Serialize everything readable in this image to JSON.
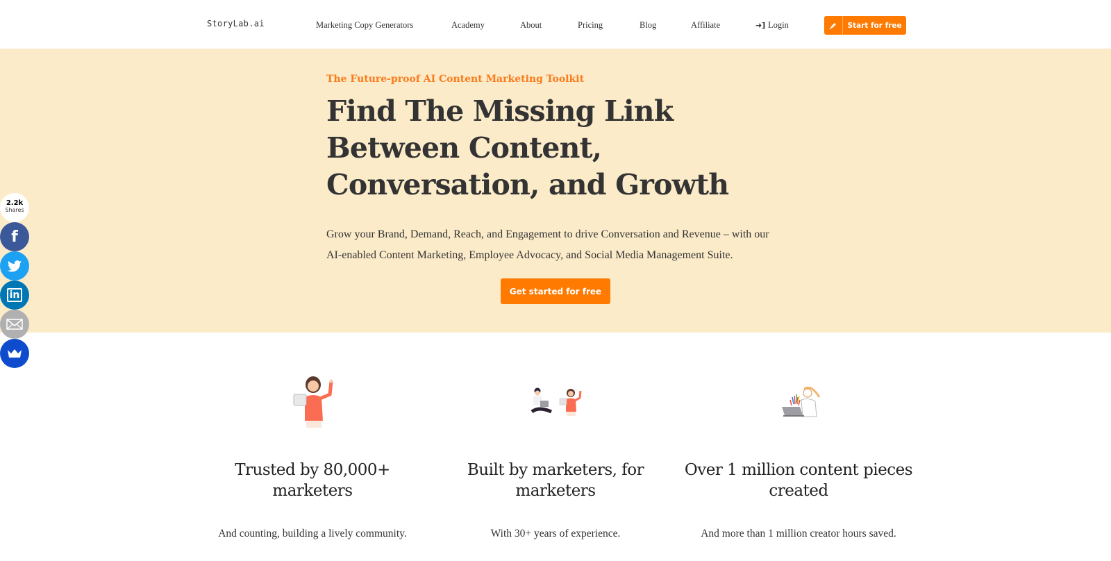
{
  "header": {
    "logo": "StoryLab.ai",
    "nav": [
      {
        "label": "Marketing Copy Generators"
      },
      {
        "label": "Academy"
      },
      {
        "label": "About"
      },
      {
        "label": "Pricing"
      },
      {
        "label": "Blog"
      },
      {
        "label": "Affiliate"
      }
    ],
    "login": {
      "label": "Login",
      "icon": "login-icon"
    },
    "start_button": {
      "label": "Start for free",
      "icon": "pen-icon"
    }
  },
  "hero": {
    "eyebrow": "The Future-proof AI Content Marketing Toolkit",
    "headline": "Find The Missing Link Between Content, Conversation, and Growth",
    "subtext": "Grow your Brand, Demand, Reach, and Engagement to drive Conversation and Revenue – with our AI-enabled Content Marketing, Employee Advocacy, and Social Media Management Suite.",
    "cta": "Get started for free",
    "background_color": "#fbebc9",
    "accent_color": "#ff7a00"
  },
  "share": {
    "count": "2.2k",
    "count_label": "Shares",
    "buttons": [
      {
        "network": "facebook",
        "icon": "facebook-icon",
        "color": "#3b5998"
      },
      {
        "network": "twitter",
        "icon": "twitter-icon",
        "color": "#1da1f2"
      },
      {
        "network": "linkedin",
        "icon": "linkedin-icon",
        "color": "#0077b5"
      },
      {
        "network": "email",
        "icon": "email-icon",
        "color": "#b0b0b0"
      },
      {
        "network": "sumo",
        "icon": "crown-icon",
        "color": "#0e4bcd"
      }
    ]
  },
  "features": [
    {
      "illustration": "woman-with-laptop-illustration",
      "title": "Trusted by 80,000+ marketers",
      "description": "And counting, building a lively community."
    },
    {
      "illustration": "two-marketers-with-laptops-illustration",
      "title": "Built by marketers, for marketers",
      "description": "With 30+ years of experience."
    },
    {
      "illustration": "creator-with-laptop-illustration",
      "title": "Over 1 million content pieces created",
      "description": "And more than 1 million creator hours saved."
    }
  ]
}
